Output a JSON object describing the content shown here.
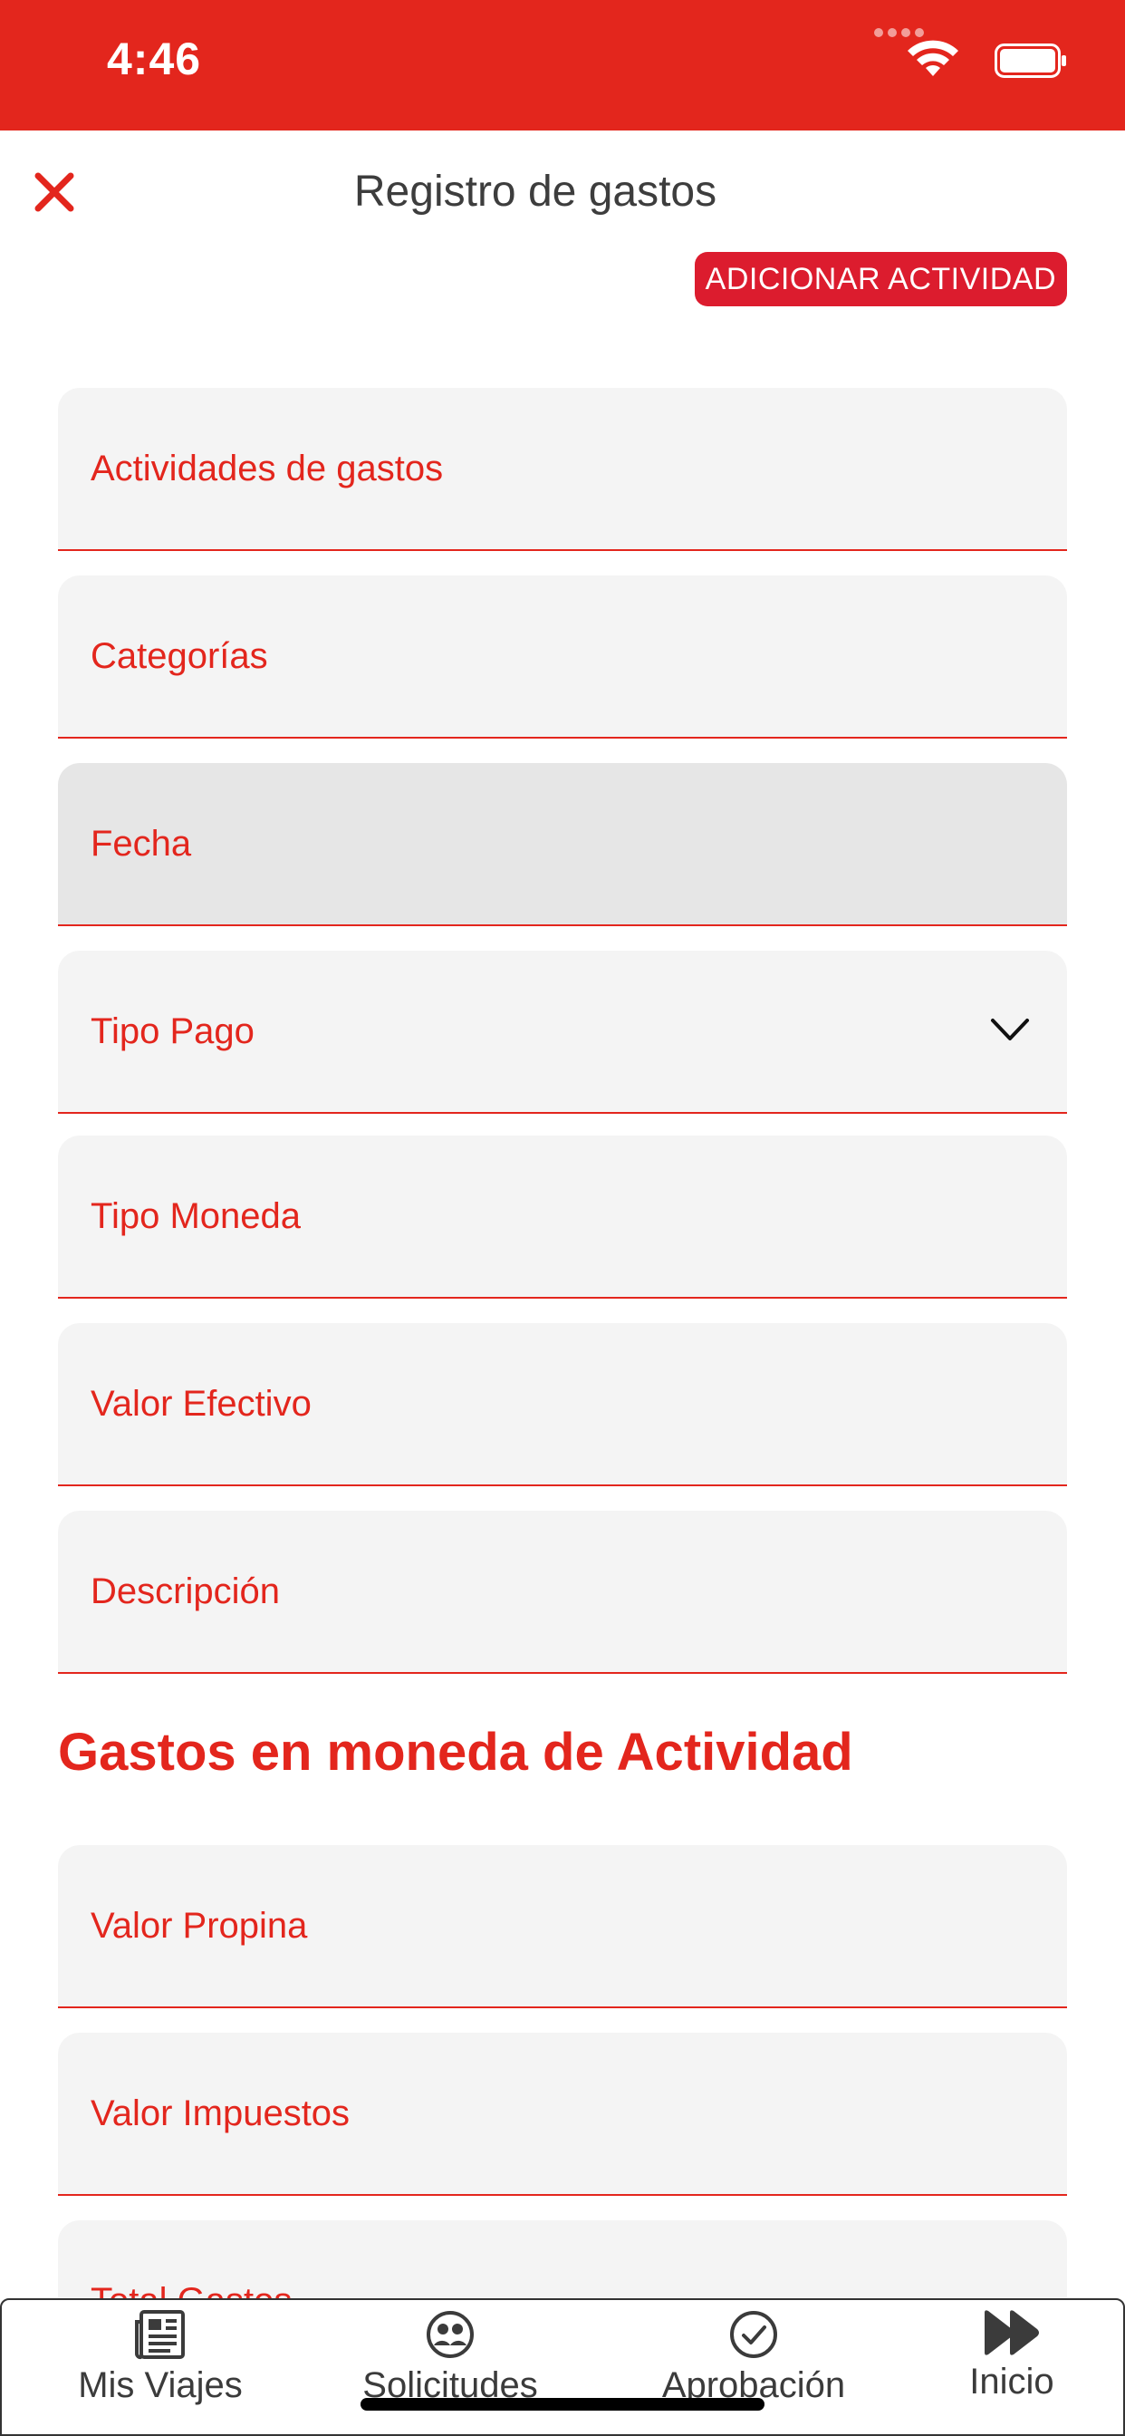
{
  "status": {
    "time": "4:46"
  },
  "header": {
    "title": "Registro de gastos",
    "add_button_label": "ADICIONAR ACTIVIDAD"
  },
  "form": {
    "fields": [
      {
        "label": "Actividades de gastos"
      },
      {
        "label": "Categorías"
      },
      {
        "label": "Fecha"
      },
      {
        "label": "Tipo Pago"
      },
      {
        "label": "Tipo Moneda"
      },
      {
        "label": "Valor Efectivo"
      },
      {
        "label": "Descripción"
      }
    ],
    "section_title": "Gastos en moneda de Actividad",
    "activity_fields": [
      {
        "label": "Valor Propina"
      },
      {
        "label": "Valor Impuestos"
      },
      {
        "label": "Total Gastos"
      }
    ]
  },
  "tabbar": {
    "tabs": [
      {
        "label": "Mis Viajes",
        "icon": "newspaper-icon"
      },
      {
        "label": "Solicitudes",
        "icon": "users-icon"
      },
      {
        "label": "Aprobación",
        "icon": "check-circle-icon"
      },
      {
        "label": "Inicio",
        "icon": "fast-forward-icon"
      }
    ]
  },
  "colors": {
    "brand_red": "#e3261d",
    "button_red": "#dc1c2e",
    "field_bg": "#f4f4f4",
    "field_focused_bg": "#e6e6e6"
  }
}
